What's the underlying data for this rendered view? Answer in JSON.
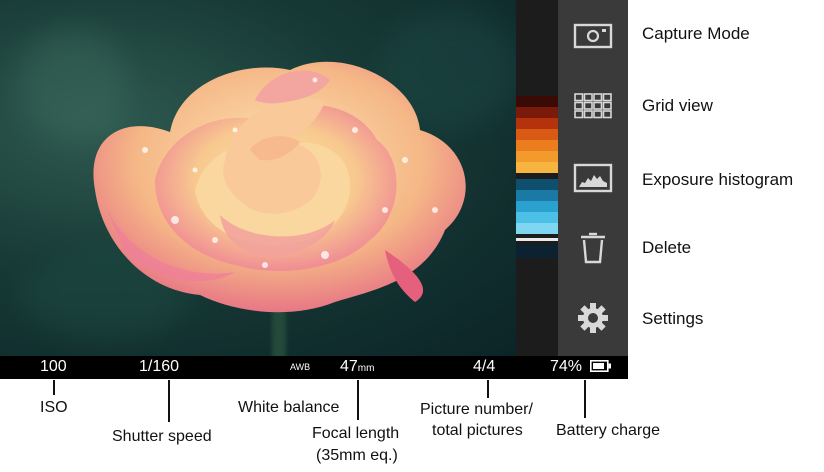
{
  "status": {
    "iso": "100",
    "shutter": "1/160",
    "white_balance": "AWB",
    "focal_length": "47",
    "focal_unit": "mm",
    "picture_counter": "4/4",
    "battery": "74%"
  },
  "menu": [
    {
      "label": "Capture Mode",
      "icon": "camera-icon"
    },
    {
      "label": "Grid view",
      "icon": "grid-icon"
    },
    {
      "label": "Exposure histogram",
      "icon": "histogram-icon"
    },
    {
      "label": "Delete",
      "icon": "trash-icon"
    },
    {
      "label": "Settings",
      "icon": "gear-icon"
    }
  ],
  "annotations": {
    "iso": "ISO",
    "shutter": "Shutter speed",
    "white_balance": "White balance",
    "focal_line1": "Focal length",
    "focal_line2": "(35mm eq.)",
    "picture_line1": "Picture number/",
    "picture_line2": "total pictures",
    "battery": "Battery charge"
  },
  "histogram_colors": {
    "warm": [
      "#3a0a04",
      "#7a1a0a",
      "#b4320c",
      "#d85a14",
      "#ec7d1e",
      "#f39a2c",
      "#f7b440"
    ],
    "cool": [
      "#0f4f6e",
      "#1a79a5",
      "#2aa1cf",
      "#4cc0e6",
      "#7fd6f0"
    ]
  }
}
